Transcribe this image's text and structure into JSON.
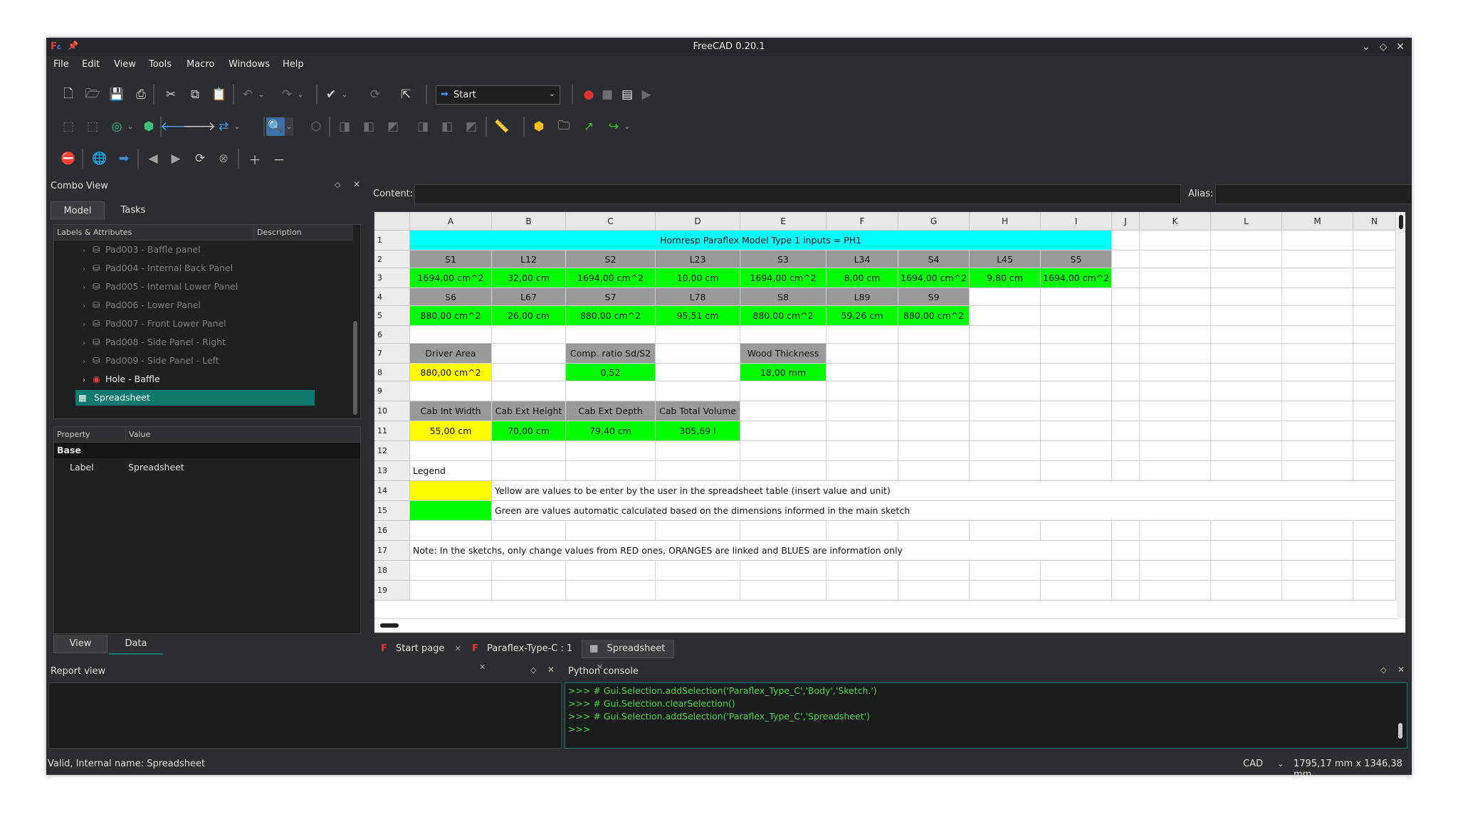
{
  "window": {
    "title": "FreeCAD 0.20.1",
    "buttons": [
      "chevron-down",
      "restore",
      "close"
    ]
  },
  "menu": [
    "File",
    "Edit",
    "View",
    "Tools",
    "Macro",
    "Windows",
    "Help"
  ],
  "workbench": {
    "selected": "Start"
  },
  "combo_view": {
    "title": "Combo View",
    "tabs": [
      "Model",
      "Tasks"
    ],
    "tree_columns": [
      "Labels & Attributes",
      "Description"
    ],
    "tree_items": [
      {
        "label": "Pad003 - Baffle panel",
        "dim": true
      },
      {
        "label": "Pad004 - Internal Back Panel",
        "dim": true
      },
      {
        "label": "Pad005 - Internal Lower Panel",
        "dim": true
      },
      {
        "label": "Pad006 - Lower Panel",
        "dim": true
      },
      {
        "label": "Pad007 - Front Lower Panel",
        "dim": true
      },
      {
        "label": "Pad008 - Side Panel - Right",
        "dim": true
      },
      {
        "label": "Pad009 - Side Panel - Left",
        "dim": true
      },
      {
        "label": "Hole - Baffle",
        "dim": false
      },
      {
        "label": "Spreadsheet",
        "dim": false,
        "selected": true
      }
    ],
    "property_columns": [
      "Property",
      "Value"
    ],
    "property_group": "Base",
    "property_rows": [
      {
        "name": "Label",
        "value": "Spreadsheet"
      }
    ],
    "bottom_tabs": [
      "View",
      "Data"
    ]
  },
  "sheet_editor": {
    "content_label": "Content:",
    "alias_label": "Alias:",
    "columns": [
      "A",
      "B",
      "C",
      "D",
      "E",
      "F",
      "G",
      "H",
      "I",
      "J",
      "K",
      "L",
      "M",
      "N"
    ],
    "rows": [
      "1",
      "2",
      "3",
      "4",
      "5",
      "6",
      "7",
      "8",
      "9",
      "10",
      "11",
      "12",
      "13",
      "14",
      "15",
      "16",
      "17",
      "18",
      "19"
    ]
  },
  "cells": {
    "r1": "Hornresp Paraflex Model Type 1 inputs = PH1",
    "r2": [
      "S1",
      "L12",
      "S2",
      "L23",
      "S3",
      "L34",
      "S4",
      "L45",
      "S5"
    ],
    "r3": [
      "1694,00 cm^2",
      "32,00 cm",
      "1694,00 cm^2",
      "10,00 cm",
      "1694,00 cm^2",
      "8,00 cm",
      "1694,00 cm^2",
      "9,80 cm",
      "1694,00 cm^2"
    ],
    "r4": [
      "S6",
      "L67",
      "S7",
      "L78",
      "S8",
      "L89",
      "S9"
    ],
    "r5": [
      "880,00 cm^2",
      "26,00 cm",
      "880,00 cm^2",
      "95,51 cm",
      "880,00 cm^2",
      "59,26 cm",
      "880,00 cm^2"
    ],
    "r7": {
      "a": "Driver Area",
      "c": "Comp. ratio Sd/S2",
      "e": "Wood Thickness"
    },
    "r8": {
      "a": "880,00 cm^2",
      "c": "0,52",
      "e": "18,00 mm"
    },
    "r10": [
      "Cab Int Width",
      "Cab Ext Height",
      "Cab Ext Depth",
      "Cab Total Volume"
    ],
    "r11": [
      "55,00 cm",
      "70,00 cm",
      "79,40 cm",
      "305,69 l"
    ],
    "r13": "Legend",
    "r14": "Yellow are values to be enter by the user in the spreadsheet table (insert value and unit)",
    "r15": "Green are values automatic calculated based on the dimensions informed in the main sketch",
    "r17": "Note: In the sketchs, only change values from RED ones, ORANGES are linked and BLUES are information only"
  },
  "doc_tabs": [
    "Start page",
    "Paraflex-Type-C : 1",
    "Spreadsheet"
  ],
  "report_view": {
    "title": "Report view"
  },
  "python_console": {
    "title": "Python console",
    "lines": [
      ">>> # Gui.Selection.addSelection('Paraflex_Type_C','Body','Sketch.')",
      ">>> # Gui.Selection.clearSelection()",
      ">>> # Gui.Selection.addSelection('Paraflex_Type_C','Spreadsheet')",
      ">>>"
    ]
  },
  "status_bar": {
    "message": "Valid, Internal name: Spreadsheet",
    "nav_style": "CAD",
    "dimensions": "1795,17 mm x 1346,38 mm"
  },
  "colors": {
    "cyan": "#00ffff",
    "green": "#00ff00",
    "yellow": "#ffff00",
    "grey": "#9a9a9a",
    "selection": "#0d7a6b"
  }
}
